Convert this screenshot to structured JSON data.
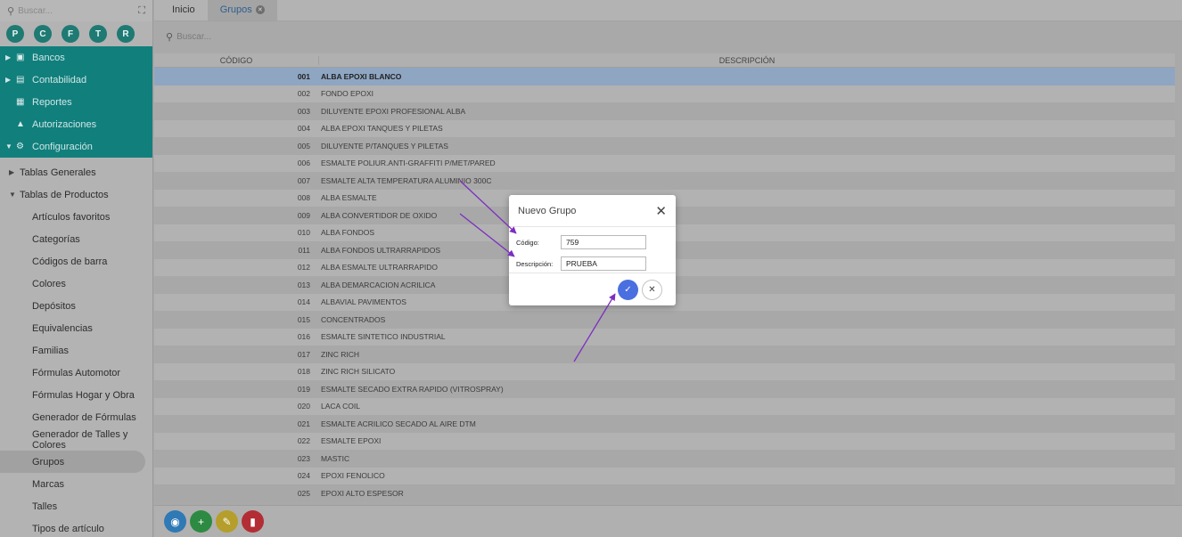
{
  "sidebar": {
    "search_placeholder": "Buscar...",
    "quick": [
      "P",
      "C",
      "F",
      "T",
      "R"
    ],
    "teal_items": [
      {
        "label": "Bancos",
        "icon": "briefcase-icon",
        "caret": true
      },
      {
        "label": "Contabilidad",
        "icon": "book-icon",
        "caret": true
      },
      {
        "label": "Reportes",
        "icon": "report-icon",
        "caret": false
      },
      {
        "label": "Autorizaciones",
        "icon": "lock-icon",
        "caret": false
      },
      {
        "label": "Configuración",
        "icon": "gears-icon",
        "caret": "open"
      }
    ],
    "config_groups": [
      {
        "label": "Tablas Generales"
      },
      {
        "label": "Tablas de Productos"
      }
    ],
    "product_items": [
      "Artículos favoritos",
      "Categorías",
      "Códigos de barra",
      "Colores",
      "Depósitos",
      "Equivalencias",
      "Familias",
      "Fórmulas Automotor",
      "Fórmulas Hogar y Obra",
      "Generador de Fórmulas",
      "Generador de Talles y Colores",
      "Grupos",
      "Marcas",
      "Talles",
      "Tipos de artículo"
    ],
    "active_item": "Grupos"
  },
  "tabs": [
    {
      "label": "Inicio",
      "active": false
    },
    {
      "label": "Grupos",
      "active": true
    }
  ],
  "main_search_placeholder": "Buscar...",
  "table": {
    "headers": [
      "CÓDIGO",
      "DESCRIPCIÓN"
    ],
    "rows": [
      [
        "001",
        "ALBA EPOXI BLANCO"
      ],
      [
        "002",
        "FONDO EPOXI"
      ],
      [
        "003",
        "DILUYENTE EPOXI PROFESIONAL ALBA"
      ],
      [
        "004",
        "ALBA EPOXI TANQUES Y PILETAS"
      ],
      [
        "005",
        "DILUYENTE P/TANQUES Y PILETAS"
      ],
      [
        "006",
        "ESMALTE POLIUR.ANTI-GRAFFITI P/MET/PARED"
      ],
      [
        "007",
        "ESMALTE ALTA TEMPERATURA ALUMINIO 300C"
      ],
      [
        "008",
        "ALBA ESMALTE"
      ],
      [
        "009",
        "ALBA CONVERTIDOR DE OXIDO"
      ],
      [
        "010",
        "ALBA FONDOS"
      ],
      [
        "011",
        "ALBA FONDOS ULTRARRAPIDOS"
      ],
      [
        "012",
        "ALBA ESMALTE ULTRARRAPIDO"
      ],
      [
        "013",
        "ALBA DEMARCACION ACRILICA"
      ],
      [
        "014",
        "ALBAVIAL PAVIMENTOS"
      ],
      [
        "015",
        "CONCENTRADOS"
      ],
      [
        "016",
        "ESMALTE SINTETICO INDUSTRIAL"
      ],
      [
        "017",
        "ZINC RICH"
      ],
      [
        "018",
        "ZINC RICH SILICATO"
      ],
      [
        "019",
        "ESMALTE SECADO EXTRA RAPIDO (VITROSPRAY)"
      ],
      [
        "020",
        "LACA COIL"
      ],
      [
        "021",
        "ESMALTE ACRILICO SECADO AL AIRE DTM"
      ],
      [
        "022",
        "ESMALTE EPOXI"
      ],
      [
        "023",
        "MASTIC"
      ],
      [
        "024",
        "EPOXI FENOLICO"
      ],
      [
        "025",
        "EPOXI ALTO ESPESOR"
      ]
    ],
    "selected_index": 0
  },
  "modal": {
    "title": "Nuevo Grupo",
    "codigo_label": "Código:",
    "codigo_value": "759",
    "descripcion_label": "Descripción:",
    "descripcion_value": "PRUEBA"
  },
  "colors": {
    "teal": "#117f7c",
    "selected_row": "#8fa6c2",
    "ok_button": "#4a6fe0",
    "annotation_arrow": "#7b2fc0"
  }
}
